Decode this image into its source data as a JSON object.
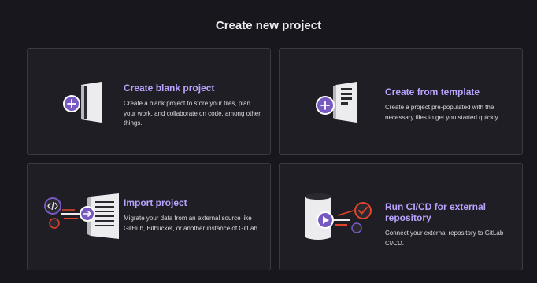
{
  "page": {
    "title": "Create new project"
  },
  "cards": [
    {
      "title": "Create blank project",
      "description": "Create a blank project to store your files, plan your work, and collaborate on code, among other things."
    },
    {
      "title": "Create from template",
      "description": "Create a project pre-populated with the necessary files to get you started quickly."
    },
    {
      "title": "Import project",
      "description": "Migrate your data from an external source like GitHub, Bitbucket, or another instance of GitLab."
    },
    {
      "title": "Run CI/CD for external repository",
      "description": "Connect your external repository to GitLab CI/CD."
    }
  ],
  "icons": [
    "plus-icon",
    "template-plus-icon",
    "code-icon",
    "arrow-right-icon",
    "play-icon",
    "check-icon"
  ],
  "colors": {
    "accent": "#7759c2",
    "accent_light": "#b9a3ff",
    "orange": "#e2432a",
    "background": "#18171d",
    "card_background": "#1f1e24",
    "card_border": "#3b3a43"
  }
}
